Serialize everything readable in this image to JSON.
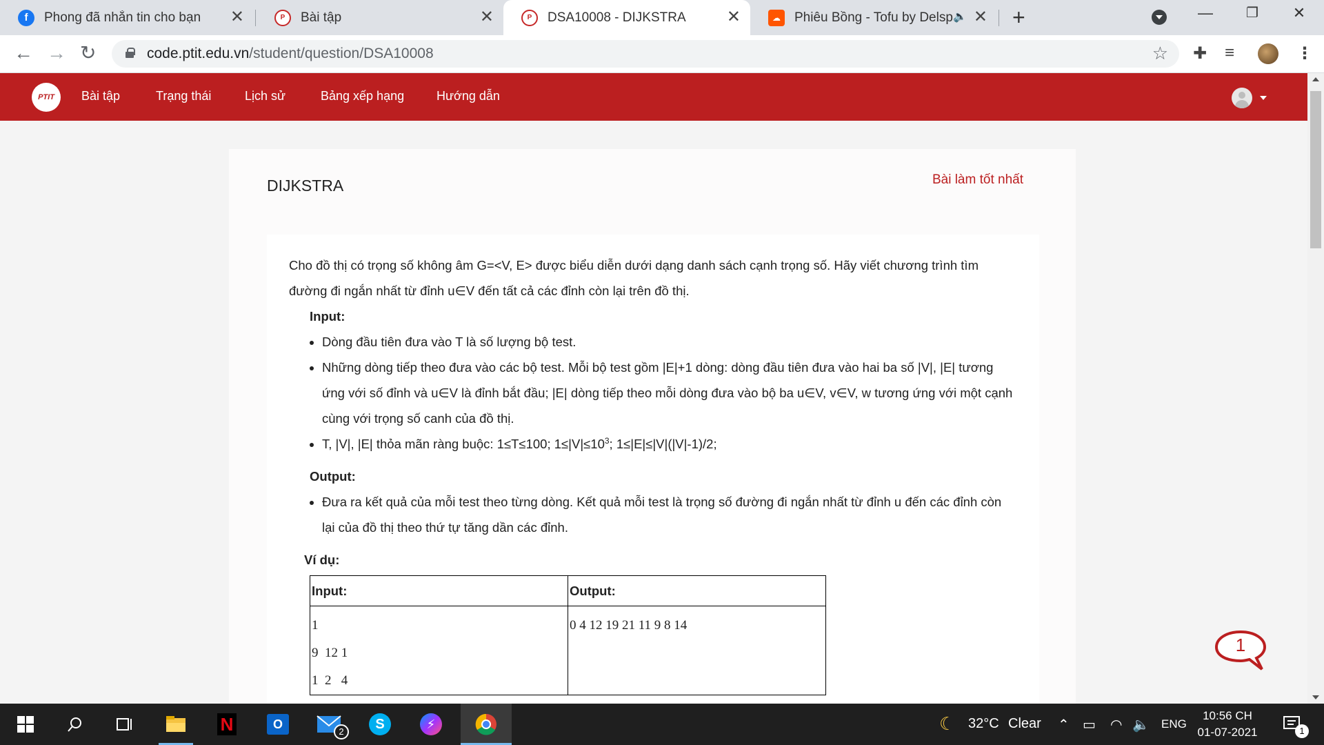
{
  "browser": {
    "tabs": [
      {
        "title": "Phong đã nhắn tin cho bạn",
        "icon": "facebook-icon"
      },
      {
        "title": "Bài tập",
        "icon": "ptit-icon"
      },
      {
        "title": "DSA10008 - DIJKSTRA",
        "icon": "ptit-icon",
        "active": true
      },
      {
        "title": "Phiêu Bồng - Tofu by Delspx",
        "icon": "soundcloud-icon",
        "audio": true
      }
    ],
    "url_host": "code.ptit.edu.vn",
    "url_path": "/student/question/DSA10008"
  },
  "site": {
    "logo_text": "PTIT",
    "nav": [
      "Bài tập",
      "Trạng thái",
      "Lịch sử",
      "Bảng xếp hạng",
      "Hướng dẫn"
    ],
    "accent_color": "#bb1f20"
  },
  "problem": {
    "title": "DIJKSTRA",
    "best_link": "Bài làm tốt nhất",
    "intro": "Cho đồ thị có trọng số không âm G=<V, E> được biểu diễn dưới dạng danh sách cạnh trọng số. Hãy viết chương trình tìm đường đi ngắn nhất từ đỉnh u∈V đến tất cả các đỉnh còn lại trên đồ thị.",
    "input_label": "Input:",
    "input_items": [
      "Dòng đầu tiên đưa vào T là số lượng bộ test.",
      "Những dòng tiếp theo đưa vào các bộ test. Mỗi bộ test gồm |E|+1 dòng: dòng đầu tiên đưa vào hai ba số |V|, |E| tương ứng với số đỉnh và u∈V là đỉnh bắt đầu; |E| dòng tiếp theo mỗi dòng đưa vào bộ ba u∈V, v∈V, w tương ứng với một cạnh cùng với trọng số canh của đồ thị."
    ],
    "constraint_prefix": "T, |V|, |E| thỏa mãn ràng buộc: 1≤T≤100; 1≤|V|≤10",
    "constraint_sup": "3",
    "constraint_suffix": "; 1≤|E|≤|V|(|V|-1)/2;",
    "output_label": "Output:",
    "output_items": [
      "Đưa ra kết quả của mỗi test theo từng dòng. Kết quả mỗi test là trọng số đường đi ngắn nhất từ đỉnh u đến các đỉnh còn lại của đồ thị theo thứ tự tăng dần các đỉnh."
    ],
    "example_label": "Ví dụ:",
    "example": {
      "input_header": "Input:",
      "output_header": "Output:",
      "input_value": "1\n9  12 1\n1  2   4",
      "output_value": "0 4 12 19 21 11 9 8 14"
    }
  },
  "chat": {
    "count": "1"
  },
  "taskbar": {
    "weather_temp": "32°C",
    "weather_text": "Clear",
    "language": "ENG",
    "time": "10:56 CH",
    "date": "01-07-2021",
    "mail_badge": "2",
    "notif_badge": "1"
  }
}
